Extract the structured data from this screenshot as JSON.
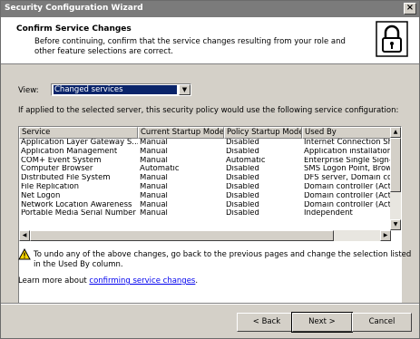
{
  "window": {
    "title": "Security Configuration Wizard",
    "close_label": "×"
  },
  "header": {
    "title": "Confirm Service Changes",
    "description": "Before continuing, confirm that the service changes resulting from your role and other feature selections are correct."
  },
  "view": {
    "label": "View:",
    "selected": "Changed services"
  },
  "policy_text": "If applied to the selected server, this security policy would use the following service configuration:",
  "table": {
    "columns": [
      "Service",
      "Current Startup Mode",
      "Policy Startup Mode",
      "Used By"
    ],
    "rows": [
      [
        "Application Layer Gateway S...",
        "Manual",
        "Disabled",
        "Internet Connection Sh"
      ],
      [
        "Application Management",
        "Manual",
        "Disabled",
        "Application installation i"
      ],
      [
        "COM+ Event System",
        "Manual",
        "Automatic",
        "Enterprise Single Sign-O"
      ],
      [
        "Computer Browser",
        "Automatic",
        "Disabled",
        "SMS Logon Point, Brow"
      ],
      [
        "Distributed File System",
        "Manual",
        "Disabled",
        "DFS server, Domain co"
      ],
      [
        "File Replication",
        "Manual",
        "Disabled",
        "Domain controller (Activ"
      ],
      [
        "Net Logon",
        "Manual",
        "Disabled",
        "Domain controller (Activ"
      ],
      [
        "Network Location Awareness",
        "Manual",
        "Disabled",
        "Domain controller (Activ"
      ],
      [
        "Portable Media Serial Number",
        "Manual",
        "Disabled",
        "Independent"
      ]
    ]
  },
  "warning": {
    "text": "To undo any of the above changes, go back to the previous pages and change the selection listed in the Used By column."
  },
  "learn": {
    "prefix": "Learn more about ",
    "link": "confirming service changes",
    "suffix": "."
  },
  "buttons": {
    "back": "< Back",
    "next": "Next >",
    "cancel": "Cancel"
  }
}
